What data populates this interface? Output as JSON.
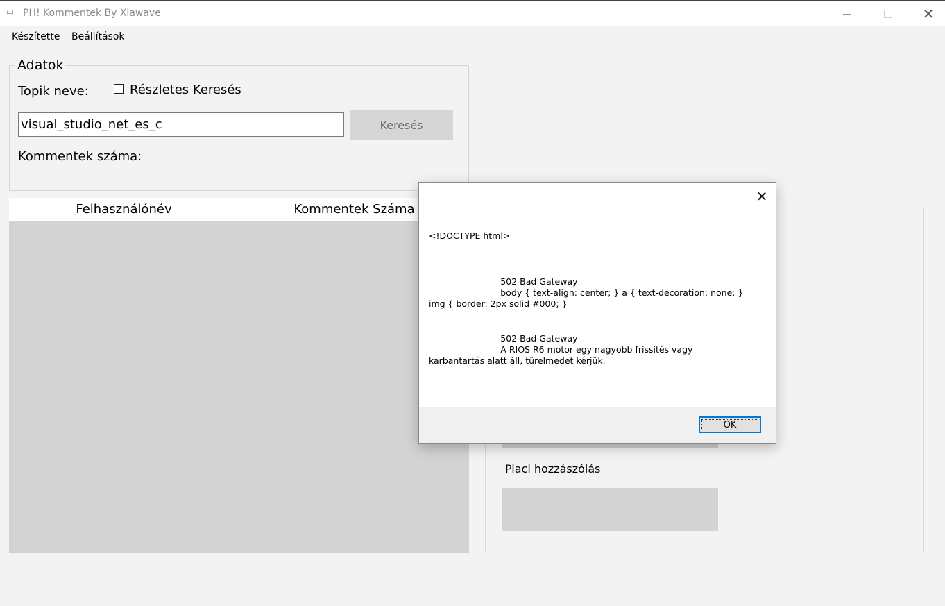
{
  "window": {
    "title": "PH! Kommentek By Xiawave",
    "app_icon": "app-icon",
    "close_glyph": "✕"
  },
  "menu": {
    "items": [
      {
        "label": "Készítette"
      },
      {
        "label": "Beállítások"
      }
    ]
  },
  "data_group": {
    "legend": "Adatok",
    "topic_label": "Topik neve:",
    "detailed_search_label": "Részletes Keresés",
    "detailed_search_checked": false,
    "topic_value": "visual_studio_net_es_c",
    "search_button": "Keresés",
    "comment_count_label": "Kommentek száma:"
  },
  "grid": {
    "columns": [
      "Felhasználónév",
      "Kommentek Száma"
    ],
    "rows": []
  },
  "right_panel": {
    "market_comment_label": "Piaci hozzászólás"
  },
  "dialog": {
    "close_glyph": "✕",
    "message": "<!DOCTYPE html>\n\n\n\n                          502 Bad Gateway\n                          body { text-align: center; } a { text-decoration: none; }\nimg { border: 2px solid #000; }\n\n\n                          502 Bad Gateway\n                          A RIOS R6 motor egy nagyobb frissítés vagy\nkarbantartás alatt áll, türelmedet kérjük.",
    "ok_button": "OK"
  },
  "colors": {
    "accent": "#0078d7",
    "window_bg": "#f3f3f3",
    "gray_panel": "#d3d3d3"
  }
}
